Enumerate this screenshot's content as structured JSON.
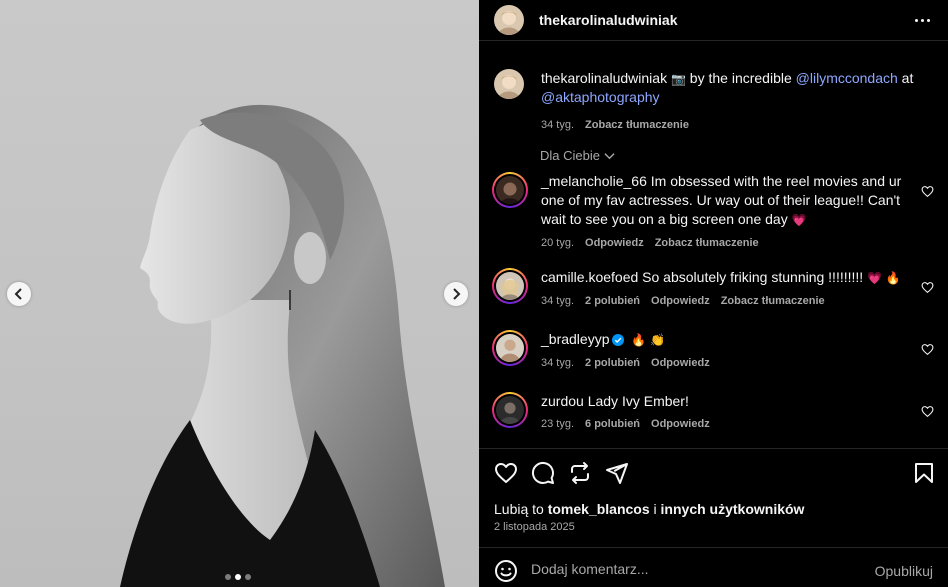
{
  "post": {
    "username": "thekarolinaludwiniak",
    "caption": {
      "username": "thekarolinaludwiniak",
      "camera_emoji": "📷",
      "text_before": " by the incredible ",
      "mention_1": "@lilymccondach",
      "text_middle": " at ",
      "mention_2": "@aktaphotography",
      "time": "34 tyg.",
      "translate": "Zobacz tłumaczenie"
    },
    "carousel": {
      "count": 3,
      "active_index": 1
    }
  },
  "for_you_label": "Dla Ciebie",
  "comments": [
    {
      "username": "_melancholie_66",
      "text": "Im obsessed with the reel movies and ur one of my fav actresses. Ur way out of their league!! Can't wait to see you on a big screen one day",
      "emoji": "💗",
      "time": "20 tyg.",
      "likes": "",
      "reply": "Odpowiedz",
      "translate": "Zobacz tłumaczenie"
    },
    {
      "username": "camille.koefoed",
      "text": "So absolutely friking stunning !!!!!!!!!",
      "emoji": "💗 🔥",
      "time": "34 tyg.",
      "likes": "2 polubień",
      "reply": "Odpowiedz",
      "translate": "Zobacz tłumaczenie"
    },
    {
      "username": "_bradleyyp",
      "verified": true,
      "text": "",
      "emoji": "🔥 👏",
      "time": "34 tyg.",
      "likes": "2 polubień",
      "reply": "Odpowiedz"
    },
    {
      "username": "zurdou",
      "text": "Lady Ivy Ember!",
      "emoji": "",
      "time": "23 tyg.",
      "likes": "6 polubień",
      "reply": "Odpowiedz"
    }
  ],
  "likes_line": {
    "prefix": "Lubią to ",
    "user": "tomek_blancos",
    "middle": " i ",
    "rest": "innych użytkowników"
  },
  "post_date": "2 listopada 2025",
  "composer": {
    "placeholder": "Dodaj komentarz...",
    "publish_label": "Opublikuj"
  },
  "icons": {
    "like": "heart-icon",
    "comment": "comment-icon",
    "repost": "repost-icon",
    "share": "share-icon",
    "save": "bookmark-icon",
    "emoji": "emoji-icon",
    "more": "more-icon"
  },
  "colors": {
    "background": "#000000",
    "text": "#f5f5f5",
    "secondary": "#a8a8a8",
    "mention": "#8ea7ff",
    "divider": "#262626"
  }
}
